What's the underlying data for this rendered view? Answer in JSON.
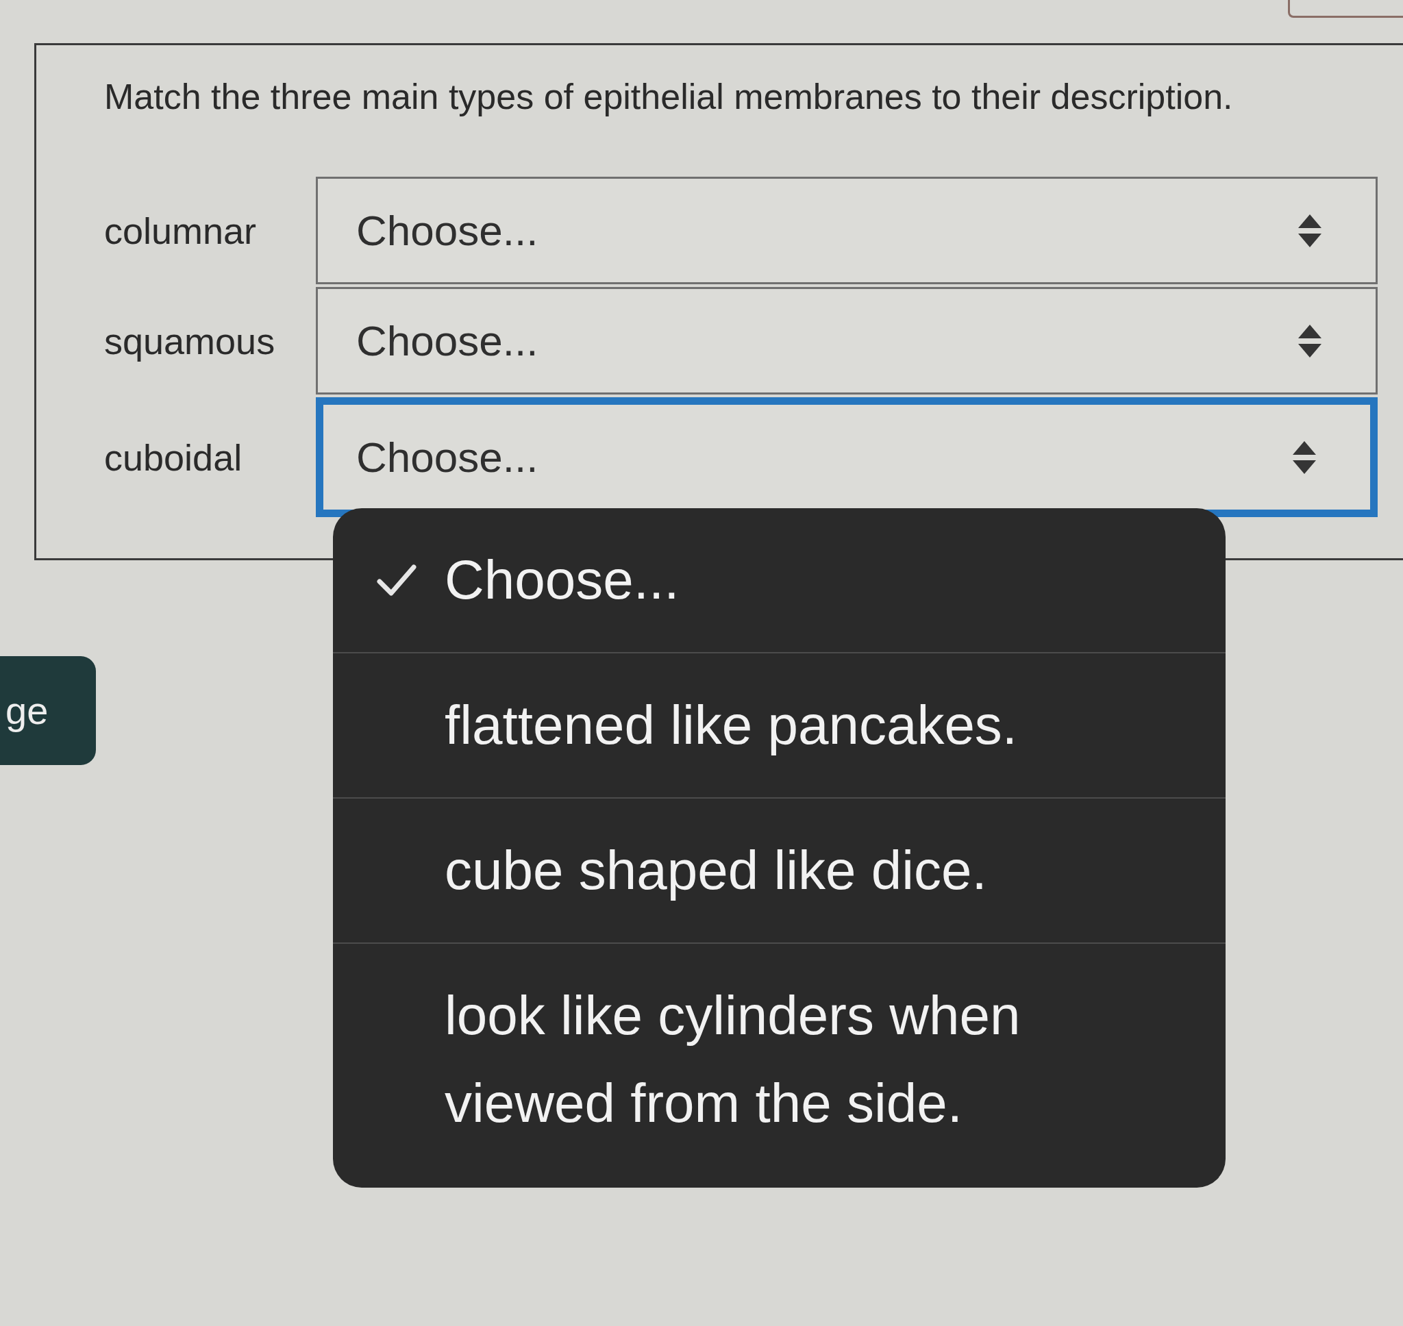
{
  "question": {
    "text": "Match the three main types of epithelial membranes to their description."
  },
  "rows": [
    {
      "term": "columnar",
      "value": "Choose...",
      "focused": false
    },
    {
      "term": "squamous",
      "value": "Choose...",
      "focused": false
    },
    {
      "term": "cuboidal",
      "value": "Choose...",
      "focused": true
    }
  ],
  "menu": {
    "items": [
      {
        "label": "Choose...",
        "selected": true
      },
      {
        "label": "flattened like pancakes.",
        "selected": false
      },
      {
        "label": "cube shaped like dice.",
        "selected": false
      },
      {
        "label": "look like cylinders when viewed from the side.",
        "selected": false
      }
    ]
  },
  "side_button": {
    "label": "ge"
  }
}
